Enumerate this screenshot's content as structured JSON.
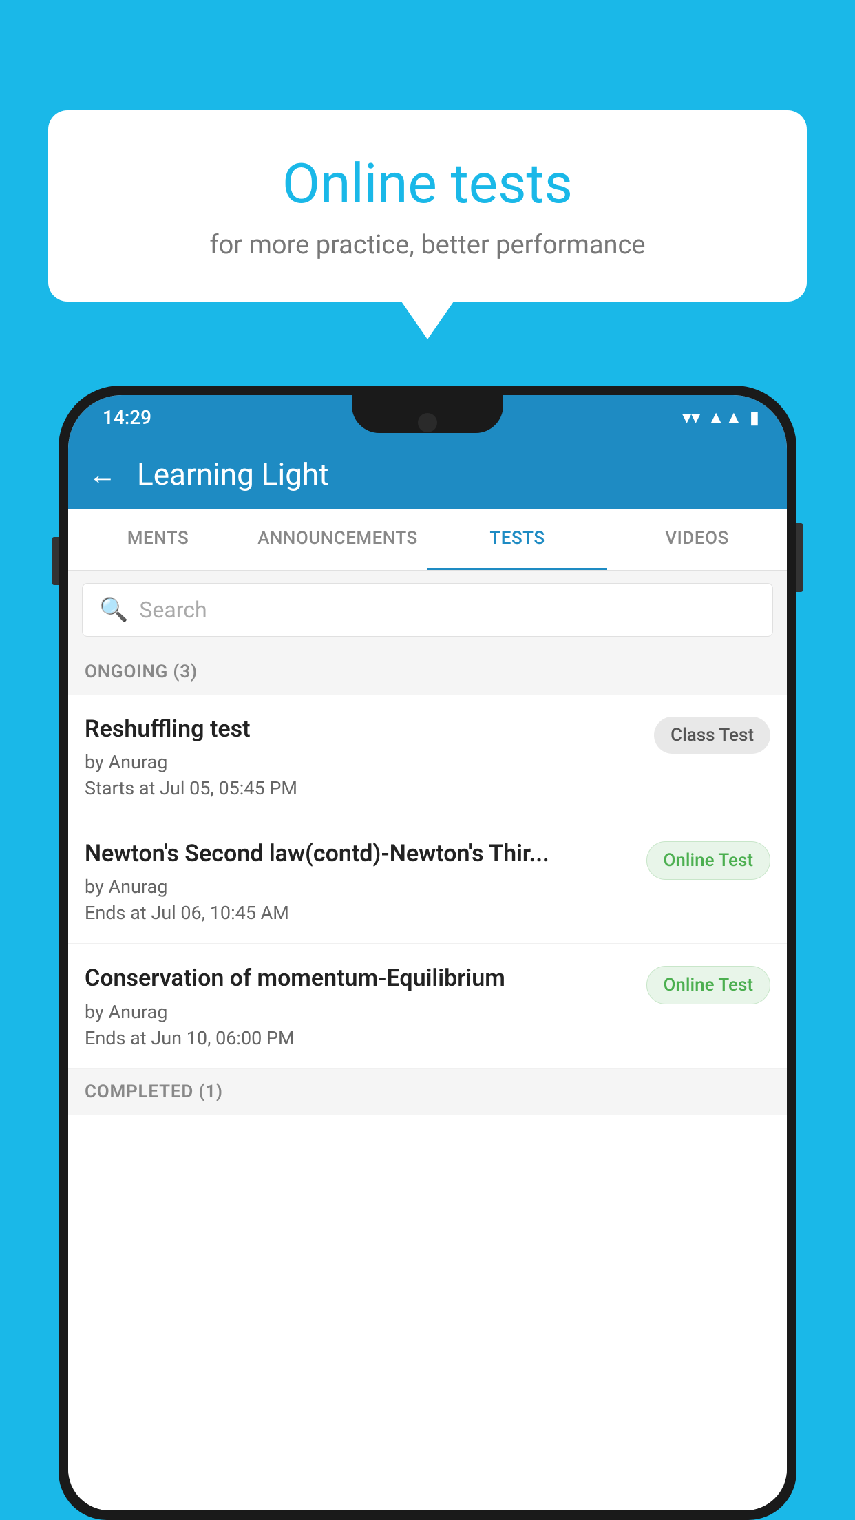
{
  "background": {
    "color": "#1ab8e8"
  },
  "speech_bubble": {
    "title": "Online tests",
    "subtitle": "for more practice, better performance"
  },
  "phone": {
    "status_bar": {
      "time": "14:29",
      "wifi_icon": "▾",
      "signal_icon": "▲",
      "battery_icon": "▮"
    },
    "header": {
      "back_label": "←",
      "title": "Learning Light"
    },
    "tabs": [
      {
        "label": "MENTS",
        "active": false
      },
      {
        "label": "ANNOUNCEMENTS",
        "active": false
      },
      {
        "label": "TESTS",
        "active": true
      },
      {
        "label": "VIDEOS",
        "active": false
      }
    ],
    "search": {
      "placeholder": "Search"
    },
    "section_ongoing": {
      "label": "ONGOING (3)"
    },
    "tests": [
      {
        "title": "Reshuffling test",
        "author": "by Anurag",
        "time_label": "Starts at  Jul 05, 05:45 PM",
        "badge": "Class Test",
        "badge_type": "class"
      },
      {
        "title": "Newton's Second law(contd)-Newton's Thir...",
        "author": "by Anurag",
        "time_label": "Ends at  Jul 06, 10:45 AM",
        "badge": "Online Test",
        "badge_type": "online"
      },
      {
        "title": "Conservation of momentum-Equilibrium",
        "author": "by Anurag",
        "time_label": "Ends at  Jun 10, 06:00 PM",
        "badge": "Online Test",
        "badge_type": "online"
      }
    ],
    "section_completed": {
      "label": "COMPLETED (1)"
    }
  }
}
